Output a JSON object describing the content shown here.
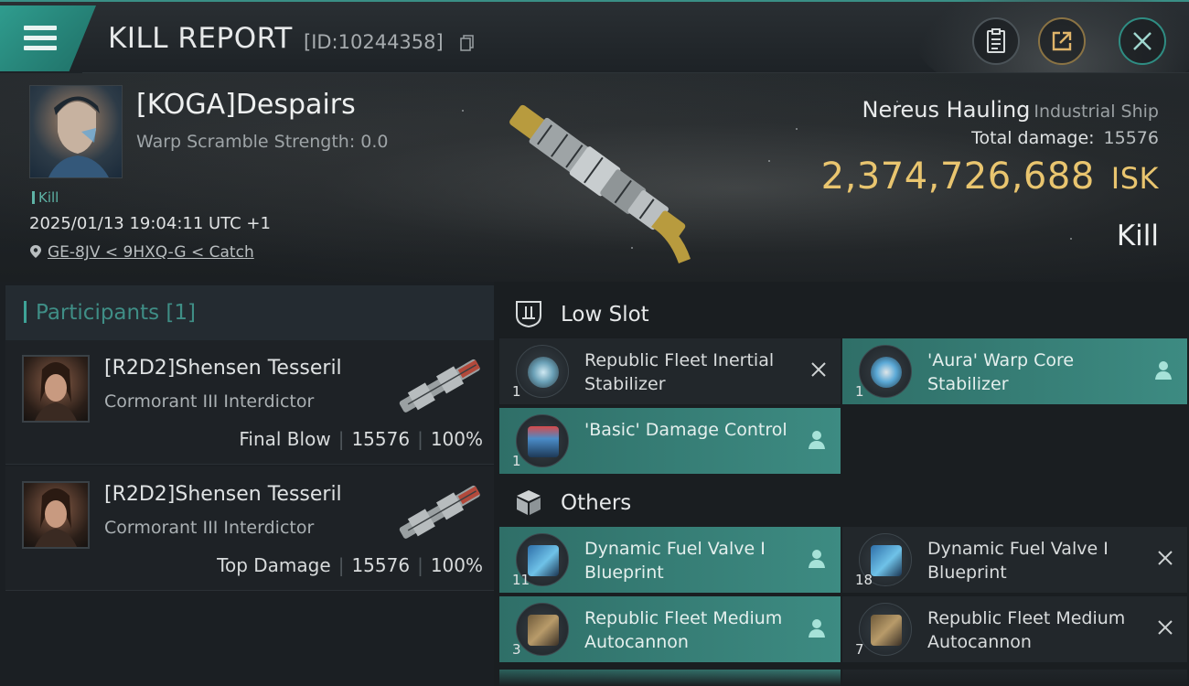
{
  "header": {
    "title": "KILL REPORT",
    "report_id": "[ID:10244358]",
    "icons": [
      "menu-icon",
      "copy-icon",
      "clipboard-icon",
      "share-icon",
      "close-icon"
    ]
  },
  "victim": {
    "pilot": "[KOGA]Despairs",
    "warp_scramble": "Warp Scramble Strength: 0.0",
    "tag": "Kill",
    "datetime": "2025/01/13 19:04:11 UTC +1",
    "location": "GE-8JV < 9HXQ-G < Catch",
    "ship_name": "Nereus Hauling",
    "ship_class": "Industrial Ship",
    "total_damage_label": "Total damage:",
    "total_damage": "15576",
    "isk_value": "2,374,726,688",
    "isk_unit": "ISK",
    "result": "Kill"
  },
  "participants": {
    "title": "Participants [1]",
    "rows": [
      {
        "name": "[R2D2]Shensen Tesseril",
        "ship": "Cormorant III Interdictor",
        "role": "Final Blow",
        "damage": "15576",
        "percent": "100%"
      },
      {
        "name": "[R2D2]Shensen Tesseril",
        "ship": "Cormorant III Interdictor",
        "role": "Top Damage",
        "damage": "15576",
        "percent": "100%"
      }
    ]
  },
  "fitting": {
    "low_slot_label": "Low Slot",
    "others_label": "Others",
    "low_slot": [
      {
        "name": "Republic Fleet Inertial Stabilizer",
        "qty": "1",
        "status": "destroyed"
      },
      {
        "name": "'Aura' Warp Core Stabilizer",
        "qty": "1",
        "status": "dropped"
      },
      {
        "name": "'Basic' Damage Control",
        "qty": "1",
        "status": "dropped"
      }
    ],
    "others": [
      {
        "name": "Dynamic Fuel Valve I Blueprint",
        "qty": "11",
        "status": "dropped"
      },
      {
        "name": "Dynamic Fuel Valve I Blueprint",
        "qty": "18",
        "status": "destroyed"
      },
      {
        "name": "Republic Fleet Medium Autocannon",
        "qty": "3",
        "status": "dropped"
      },
      {
        "name": "Republic Fleet Medium Autocannon",
        "qty": "7",
        "status": "destroyed"
      }
    ]
  },
  "colors": {
    "accent": "#3ea397",
    "isk": "#e9c56f",
    "dropped_bg": "#3d8b82",
    "destroyed_bg": "#22272b"
  }
}
